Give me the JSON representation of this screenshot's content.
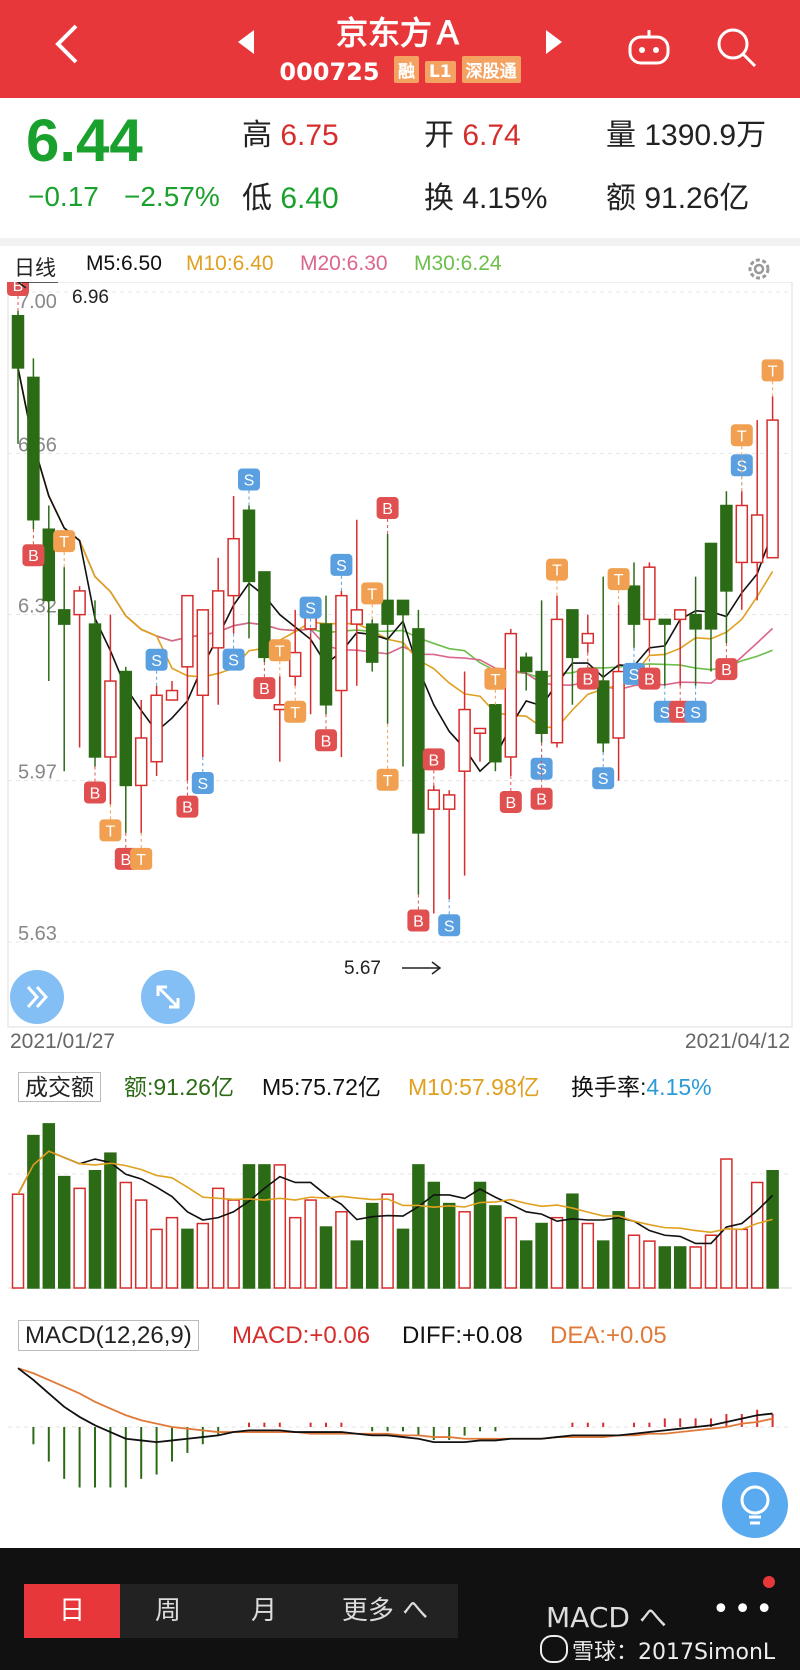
{
  "header": {
    "back_icon": "chevron-left-icon",
    "title": "京东方Ａ",
    "code": "000725",
    "tags": [
      "融",
      "L1",
      "深股通"
    ],
    "robot_icon": "robot-icon",
    "search_icon": "search-icon"
  },
  "quote": {
    "price": "6.44",
    "change": "−0.17",
    "change_pct": "−2.57%",
    "high_label": "高",
    "high": "6.75",
    "low_label": "低",
    "low": "6.40",
    "open_label": "开",
    "open": "6.74",
    "turnover_label": "换",
    "turnover": "4.15%",
    "volume_label": "量",
    "volume": "1390.9万",
    "amount_label": "额",
    "amount": "91.26亿"
  },
  "kline_bar": {
    "period": "日线",
    "ma5": "M5:6.50",
    "ma10": "M10:6.40",
    "ma20": "M20:6.30",
    "ma30": "M30:6.24",
    "settings_icon": "gear-icon"
  },
  "chart_data": [
    {
      "type": "candlestick",
      "title": "日线",
      "y_ticks": [
        "7.00",
        "6.66",
        "6.32",
        "5.97",
        "5.63"
      ],
      "ylim": [
        5.63,
        7.0
      ],
      "x_labels": [
        "2021/01/27",
        "2021/04/12"
      ],
      "annotations": {
        "high_mark": "6.96",
        "low_mark": "5.67"
      },
      "series_colors": {
        "up": "#d62d2d",
        "down": "#2c6b16",
        "ma5": "#111111",
        "ma10": "#e0a020",
        "ma20": "#d9668b",
        "ma30": "#6dbf4b"
      },
      "candles": [
        [
          6.95,
          6.84,
          6.96,
          6.68
        ],
        [
          6.82,
          6.52,
          6.86,
          6.5
        ],
        [
          6.5,
          6.35,
          6.55,
          6.18
        ],
        [
          6.33,
          6.3,
          6.42,
          5.99
        ],
        [
          6.32,
          6.37,
          6.38,
          6.04
        ],
        [
          6.3,
          6.02,
          6.35,
          6.0
        ],
        [
          6.02,
          6.18,
          6.32,
          5.92
        ],
        [
          6.2,
          5.96,
          6.21,
          5.86
        ],
        [
          5.96,
          6.06,
          6.14,
          5.86
        ],
        [
          6.01,
          6.15,
          6.17,
          5.98
        ],
        [
          6.14,
          6.16,
          6.18,
          6.14
        ],
        [
          6.21,
          6.36,
          6.28,
          5.97
        ],
        [
          6.15,
          6.33,
          6.32,
          6.02
        ],
        [
          6.25,
          6.37,
          6.44,
          6.13
        ],
        [
          6.36,
          6.48,
          6.57,
          6.28
        ],
        [
          6.54,
          6.39,
          6.55,
          6.27
        ],
        [
          6.41,
          6.23,
          6.41,
          6.22
        ],
        [
          6.12,
          6.13,
          6.19,
          6.01
        ],
        [
          6.19,
          6.24,
          6.33,
          6.17
        ],
        [
          6.29,
          6.35,
          6.28,
          6.11
        ],
        [
          6.3,
          6.13,
          6.36,
          6.11
        ],
        [
          6.16,
          6.36,
          6.37,
          6.02
        ],
        [
          6.3,
          6.33,
          6.52,
          6.17
        ],
        [
          6.3,
          6.22,
          6.31,
          6.2
        ],
        [
          6.35,
          6.3,
          6.49,
          6.09
        ],
        [
          6.35,
          6.32,
          6.3,
          6.0
        ],
        [
          6.29,
          5.86,
          6.33,
          5.73
        ],
        [
          5.91,
          5.95,
          5.96,
          5.69
        ],
        [
          5.91,
          5.94,
          5.95,
          5.72
        ],
        [
          5.99,
          6.12,
          6.2,
          5.77
        ],
        [
          6.07,
          6.08,
          6.07,
          6.01
        ],
        [
          6.13,
          6.01,
          6.13,
          5.99
        ],
        [
          6.02,
          6.28,
          6.29,
          5.98
        ],
        [
          6.23,
          6.2,
          6.24,
          6.16
        ],
        [
          6.2,
          6.07,
          6.35,
          6.05
        ],
        [
          6.05,
          6.31,
          6.36,
          6.04
        ],
        [
          6.33,
          6.23,
          6.23,
          6.13
        ],
        [
          6.26,
          6.28,
          6.32,
          6.24
        ],
        [
          6.18,
          6.05,
          6.4,
          6.03
        ],
        [
          6.06,
          6.2,
          6.34,
          5.97
        ],
        [
          6.38,
          6.3,
          6.43,
          6.25
        ],
        [
          6.31,
          6.42,
          6.43,
          6.24
        ],
        [
          6.31,
          6.3,
          6.27,
          6.17
        ],
        [
          6.31,
          6.33,
          6.28,
          6.17
        ],
        [
          6.32,
          6.29,
          6.4,
          6.17
        ],
        [
          6.47,
          6.29,
          6.45,
          6.2
        ],
        [
          6.55,
          6.37,
          6.58,
          6.26
        ],
        [
          6.43,
          6.55,
          6.58,
          6.33
        ],
        [
          6.43,
          6.53,
          6.73,
          6.35
        ],
        [
          6.44,
          6.73,
          6.78,
          6.44
        ]
      ],
      "trade_marks": [
        {
          "label": "B",
          "index": 0
        },
        {
          "label": "B",
          "index": 1
        },
        {
          "label": "T",
          "index": 3
        },
        {
          "label": "B",
          "index": 5
        },
        {
          "label": "T",
          "index": 6
        },
        {
          "label": "B",
          "index": 7
        },
        {
          "label": "T",
          "index": 8
        },
        {
          "label": "S",
          "index": 9
        },
        {
          "label": "B",
          "index": 11
        },
        {
          "label": "S",
          "index": 12
        },
        {
          "label": "S",
          "index": 14
        },
        {
          "label": "S",
          "index": 15
        },
        {
          "label": "B",
          "index": 16
        },
        {
          "label": "T",
          "index": 17
        },
        {
          "label": "T",
          "index": 18
        },
        {
          "label": "S",
          "index": 19
        },
        {
          "label": "B",
          "index": 20
        },
        {
          "label": "S",
          "index": 21
        },
        {
          "label": "T",
          "index": 23
        },
        {
          "label": "B",
          "index": 24
        },
        {
          "label": "T",
          "index": 24
        },
        {
          "label": "B",
          "index": 26
        },
        {
          "label": "B",
          "index": 27
        },
        {
          "label": "S",
          "index": 28
        },
        {
          "label": "T",
          "index": 31
        },
        {
          "label": "B",
          "index": 32
        },
        {
          "label": "S",
          "index": 34
        },
        {
          "label": "B",
          "index": 34
        },
        {
          "label": "T",
          "index": 35
        },
        {
          "label": "B",
          "index": 37
        },
        {
          "label": "S",
          "index": 38
        },
        {
          "label": "T",
          "index": 39
        },
        {
          "label": "S",
          "index": 40
        },
        {
          "label": "B",
          "index": 41
        },
        {
          "label": "S",
          "index": 42
        },
        {
          "label": "B",
          "index": 43
        },
        {
          "label": "S",
          "index": 44
        },
        {
          "label": "B",
          "index": 46
        },
        {
          "label": "S",
          "index": 47
        },
        {
          "label": "T",
          "index": 47
        },
        {
          "label": "T",
          "index": 49
        }
      ]
    },
    {
      "type": "bar",
      "title": "成交额",
      "legend": {
        "amount": "额:91.26亿",
        "m5": "M5:75.72亿",
        "m10": "M10:57.98亿",
        "turnover_label": "换手率:",
        "turnover": "4.15%"
      },
      "values": [
        80,
        130,
        140,
        95,
        85,
        100,
        115,
        90,
        75,
        50,
        60,
        50,
        55,
        85,
        75,
        105,
        105,
        105,
        60,
        75,
        52,
        65,
        40,
        72,
        80,
        50,
        105,
        90,
        72,
        65,
        90,
        70,
        60,
        40,
        55,
        60,
        80,
        55,
        40,
        65,
        45,
        40,
        35,
        35,
        35,
        45,
        110,
        50,
        90,
        100
      ],
      "up_down": [
        "u",
        "d",
        "d",
        "d",
        "u",
        "d",
        "d",
        "u",
        "u",
        "u",
        "u",
        "d",
        "u",
        "u",
        "u",
        "d",
        "d",
        "u",
        "u",
        "u",
        "d",
        "u",
        "d",
        "d",
        "u",
        "d",
        "d",
        "d",
        "d",
        "u",
        "d",
        "d",
        "u",
        "d",
        "d",
        "u",
        "d",
        "u",
        "d",
        "d",
        "u",
        "u",
        "d",
        "d",
        "u",
        "u",
        "u",
        "u",
        "u",
        "d"
      ]
    },
    {
      "type": "macd",
      "title": "MACD(12,26,9)",
      "legend": {
        "macd": "MACD:+0.06",
        "diff": "DIFF:+0.08",
        "dea": "DEA:+0.05"
      },
      "diff": [
        0.35,
        0.28,
        0.2,
        0.12,
        0.06,
        0.01,
        -0.03,
        -0.07,
        -0.08,
        -0.09,
        -0.08,
        -0.07,
        -0.06,
        -0.05,
        -0.03,
        -0.02,
        -0.02,
        -0.02,
        -0.03,
        -0.03,
        -0.03,
        -0.03,
        -0.04,
        -0.05,
        -0.05,
        -0.06,
        -0.07,
        -0.09,
        -0.09,
        -0.09,
        -0.08,
        -0.08,
        -0.07,
        -0.07,
        -0.07,
        -0.06,
        -0.05,
        -0.05,
        -0.05,
        -0.05,
        -0.04,
        -0.03,
        -0.02,
        -0.01,
        0.0,
        0.01,
        0.03,
        0.05,
        0.07,
        0.08
      ],
      "dea": [
        0.35,
        0.32,
        0.28,
        0.24,
        0.2,
        0.15,
        0.11,
        0.07,
        0.04,
        0.02,
        0.0,
        -0.01,
        -0.02,
        -0.03,
        -0.03,
        -0.03,
        -0.03,
        -0.03,
        -0.03,
        -0.04,
        -0.04,
        -0.04,
        -0.04,
        -0.04,
        -0.04,
        -0.05,
        -0.05,
        -0.06,
        -0.06,
        -0.07,
        -0.07,
        -0.07,
        -0.07,
        -0.07,
        -0.07,
        -0.06,
        -0.06,
        -0.06,
        -0.06,
        -0.05,
        -0.05,
        -0.04,
        -0.04,
        -0.03,
        -0.02,
        -0.01,
        0.0,
        0.02,
        0.03,
        0.05
      ]
    }
  ],
  "bottom_bar": {
    "tabs": [
      "日",
      "周",
      "月",
      "更多 へ"
    ],
    "indicator": "MACD へ",
    "more": "•••",
    "watermark": "雪球：2017SimonL",
    "bulb_icon": "lightbulb-icon",
    "zoom_icon": "expand-arrows-icon",
    "collapse_icon": "double-chevron-icon"
  }
}
